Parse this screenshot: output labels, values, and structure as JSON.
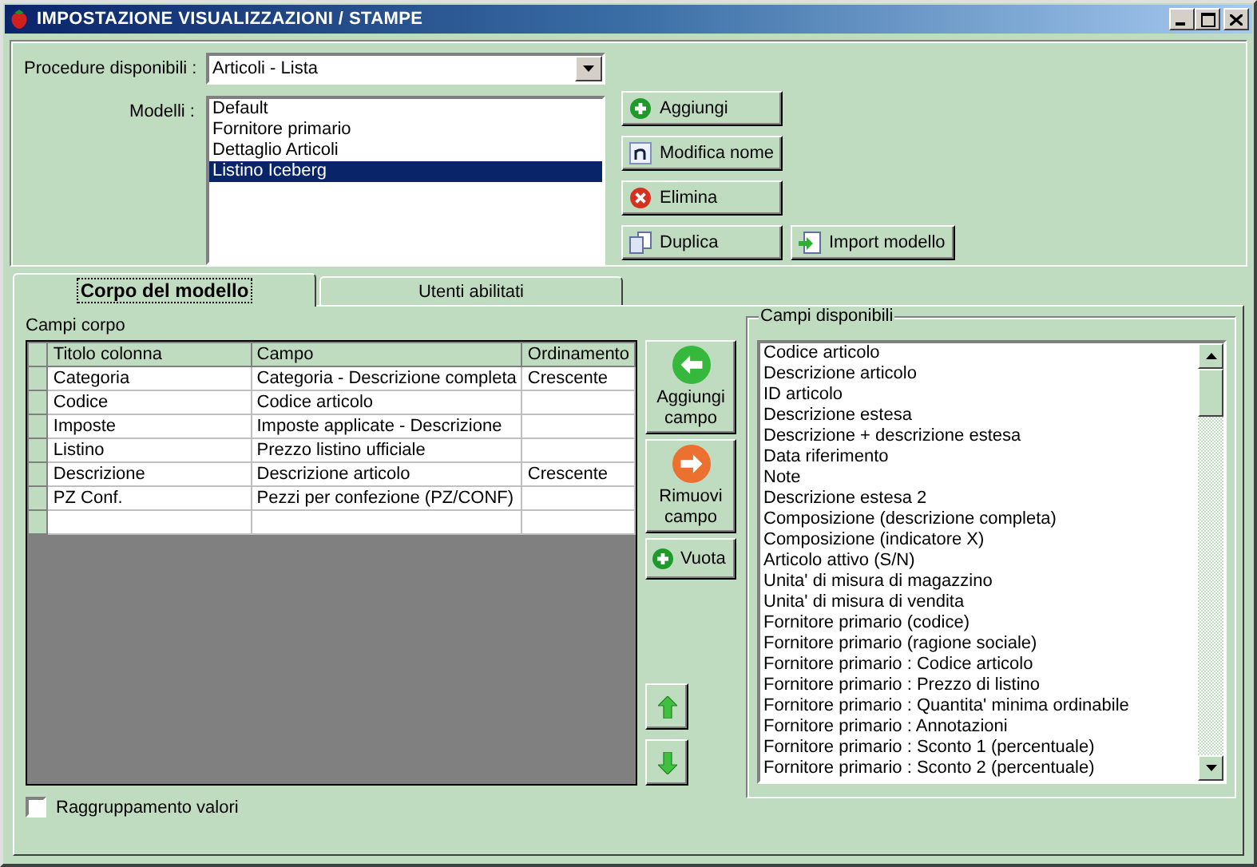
{
  "window": {
    "title": "IMPOSTAZIONE VISUALIZZAZIONI / STAMPE"
  },
  "procedure": {
    "label": "Procedure disponibili :",
    "value": "Articoli - Lista"
  },
  "modelli": {
    "label": "Modelli :",
    "items": [
      {
        "label": "Default",
        "selected": false
      },
      {
        "label": "Fornitore primario",
        "selected": false
      },
      {
        "label": "Dettaglio Articoli",
        "selected": false
      },
      {
        "label": "Listino Iceberg",
        "selected": true
      }
    ]
  },
  "model_buttons": [
    {
      "label": "Aggiungi",
      "kind": "add"
    },
    {
      "label": "Modifica nome",
      "kind": "rename"
    },
    {
      "label": "Elimina",
      "kind": "delete"
    },
    {
      "label": "Duplica",
      "kind": "duplicate"
    },
    {
      "label": "Import modello",
      "kind": "import"
    }
  ],
  "tabs": [
    {
      "label": "Corpo del modello",
      "selected": true
    },
    {
      "label": "Utenti abilitati",
      "selected": false
    }
  ],
  "campi_corpo": {
    "label": "Campi corpo",
    "columns": [
      "Titolo colonna",
      "Campo",
      "Ordinamento"
    ],
    "rows": [
      [
        "Categoria",
        "Categoria - Descrizione completa",
        "Crescente"
      ],
      [
        "Codice",
        "Codice articolo",
        ""
      ],
      [
        "Imposte",
        "Imposte applicate - Descrizione",
        ""
      ],
      [
        "Listino",
        "Prezzo listino ufficiale",
        ""
      ],
      [
        "Descrizione",
        "Descrizione articolo",
        "Crescente"
      ],
      [
        "PZ Conf.",
        "Pezzi per confezione (PZ/CONF)",
        ""
      ]
    ]
  },
  "field_buttons": [
    {
      "label": "Aggiungi campo",
      "kind": "add_field"
    },
    {
      "label": "Rimuovi campo",
      "kind": "remove_field"
    },
    {
      "label": "Vuota",
      "kind": "clear"
    }
  ],
  "grouping": {
    "label": "Raggruppamento valori",
    "checked": false
  },
  "campi_disponibili": {
    "label": "Campi disponibili",
    "items": [
      "Codice articolo",
      "Descrizione articolo",
      "ID articolo",
      "Descrizione estesa",
      "Descrizione + descrizione estesa",
      "Data riferimento",
      "Note",
      "Descrizione estesa 2",
      "Composizione (descrizione completa)",
      "Composizione (indicatore X)",
      "Articolo attivo (S/N)",
      "Unita' di misura di magazzino",
      "Unita' di misura di vendita",
      "Fornitore primario (codice)",
      "Fornitore primario (ragione sociale)",
      "Fornitore primario : Codice articolo",
      "Fornitore primario : Prezzo di listino",
      "Fornitore primario : Quantita' minima ordinabile",
      "Fornitore primario : Annotazioni",
      "Fornitore primario : Sconto 1 (percentuale)",
      "Fornitore primario : Sconto 2 (percentuale)"
    ]
  }
}
